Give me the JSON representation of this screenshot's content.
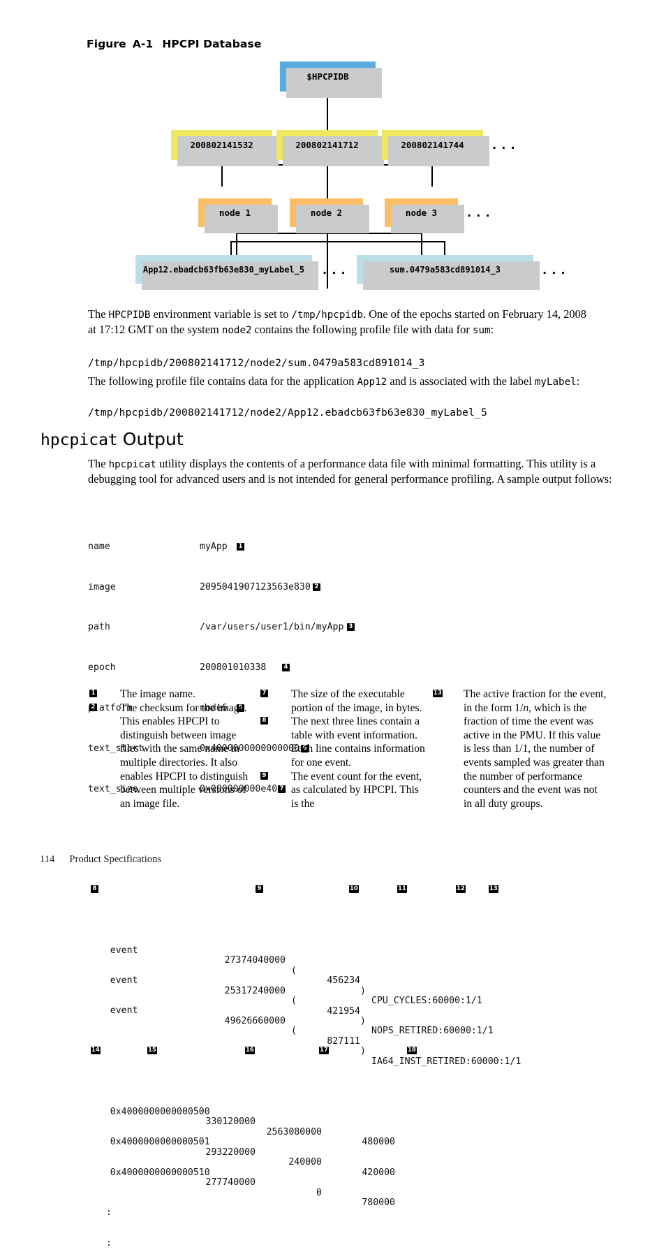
{
  "figure": {
    "label": "Figure",
    "number": "A-1",
    "title": "HPCPI Database"
  },
  "diagram": {
    "root": {
      "label": "$HPCPIDB",
      "color": "#5aabe0"
    },
    "epochs": [
      {
        "label": "200802141532",
        "color": "#eee861"
      },
      {
        "label": "200802141712",
        "color": "#eee861"
      },
      {
        "label": "200802141744",
        "color": "#eee861"
      }
    ],
    "epochs_more": "...",
    "nodes": [
      {
        "label": "node 1",
        "color": "#fbbe64"
      },
      {
        "label": "node 2",
        "color": "#fbbe64"
      },
      {
        "label": "node 3",
        "color": "#fbbe64"
      }
    ],
    "nodes_more": "...",
    "files": [
      {
        "label": "App12.ebadcb63fb63e830_myLabel_5",
        "color": "#bbdfe8"
      },
      {
        "label": "sum.0479a583cd891014_3",
        "color": "#bbdfe8"
      }
    ],
    "files_more_mid": "...",
    "files_more_end": "..."
  },
  "body": {
    "para1_a": "The ",
    "para1_env": "HPCPIDB",
    "para1_b": " environment variable is set to ",
    "para1_path": "/tmp/hpcpidb",
    "para1_c": ". One of the epochs started on February 14, 2008 at 17:12 GMT on the system ",
    "para1_node": "node2",
    "para1_d": " contains the following profile file with data for ",
    "para1_sum": "sum",
    "para1_e": ":",
    "code1": "/tmp/hpcpidb/200802141712/node2/sum.0479a583cd891014_3",
    "para2_a": "The following profile file contains data for the application ",
    "para2_app": "App12",
    "para2_b": " and is associated with the label ",
    "para2_label": "myLabel",
    "para2_c": ":",
    "code2": "/tmp/hpcpidb/200802141712/node2/App12.ebadcb63fb63e830_myLabel_5"
  },
  "heading": {
    "mono": "hpcpicat",
    "sans": "Output"
  },
  "intro": {
    "a": "The ",
    "cmd": "hpcpicat",
    "b": " utility displays the contents of a performance data file with minimal formatting. This utility is a debugging tool for advanced users and is not intended for general performance profiling. A sample output follows:"
  },
  "listing": {
    "fields": [
      {
        "name": "name",
        "value": "myApp",
        "callout": "1"
      },
      {
        "name": "image",
        "value": "2095041907123563e830",
        "callout": "2"
      },
      {
        "name": "path",
        "value": "/var/users/user1/bin/myApp",
        "callout": "3"
      },
      {
        "name": "epoch",
        "value": "200801010338",
        "callout": "4"
      },
      {
        "name": "platform",
        "value": "node6",
        "callout": "5"
      },
      {
        "name": "text_start",
        "value": "0x4000000000000000",
        "callout": "6"
      },
      {
        "name": "text_size",
        "value": "0x000000000e40",
        "callout": "7"
      }
    ],
    "event_callouts": [
      "8",
      "9",
      "10",
      "11",
      "12",
      "13"
    ],
    "events": [
      {
        "label": "event",
        "count": "27374040000",
        "samples": "456234",
        "spec": "CPU_CYCLES:60000:1/1"
      },
      {
        "label": "event",
        "count": "25317240000",
        "samples": "421954",
        "spec": "NOPS_RETIRED:60000:1/1"
      },
      {
        "label": "event",
        "count": "49626660000",
        "samples": "827111",
        "spec": "IA64_INST_RETIRED:60000:1/1"
      }
    ],
    "addr_callouts": [
      "14",
      "15",
      "16",
      "17",
      "18"
    ],
    "addresses": [
      {
        "addr": "0x4000000000000500",
        "c1": "330120000",
        "c2": "2563080000",
        "c3": "480000"
      },
      {
        "addr": "0x4000000000000501",
        "c1": "293220000",
        "c2": "240000",
        "c3": "420000"
      },
      {
        "addr": "0x4000000000000510",
        "c1": "277740000",
        "c2": "0",
        "c3": "780000"
      }
    ],
    "continuation": [
      ":",
      ":"
    ]
  },
  "legend": {
    "col1": [
      {
        "n": "1",
        "text": "The image name."
      },
      {
        "n": "2",
        "text": "The checksum for the image. This enables HPCPI to distinguish between image files with the same name in multiple directories. It also enables HPCPI to distinguish between multiple versions of an image file."
      }
    ],
    "col2": [
      {
        "n": "7",
        "text": "The size of the executable portion of the image, in bytes."
      },
      {
        "n": "8",
        "text": "The next three lines contain a table with event information. Each line contains information for one event."
      },
      {
        "n": "9",
        "text": "The event count for the event, as calculated by HPCPI. This is the"
      }
    ],
    "col3": [
      {
        "n": "13",
        "text_pre": "The active fraction for the event, in the form 1/",
        "text_italic": "n",
        "text_post": ", which is the fraction of time the event was active in the PMU. If this value is less than 1/1, the number of events sampled was greater than the number of performance counters and the event was not in all duty groups."
      }
    ]
  },
  "footer": {
    "page": "114",
    "section": "Product Specifications"
  }
}
